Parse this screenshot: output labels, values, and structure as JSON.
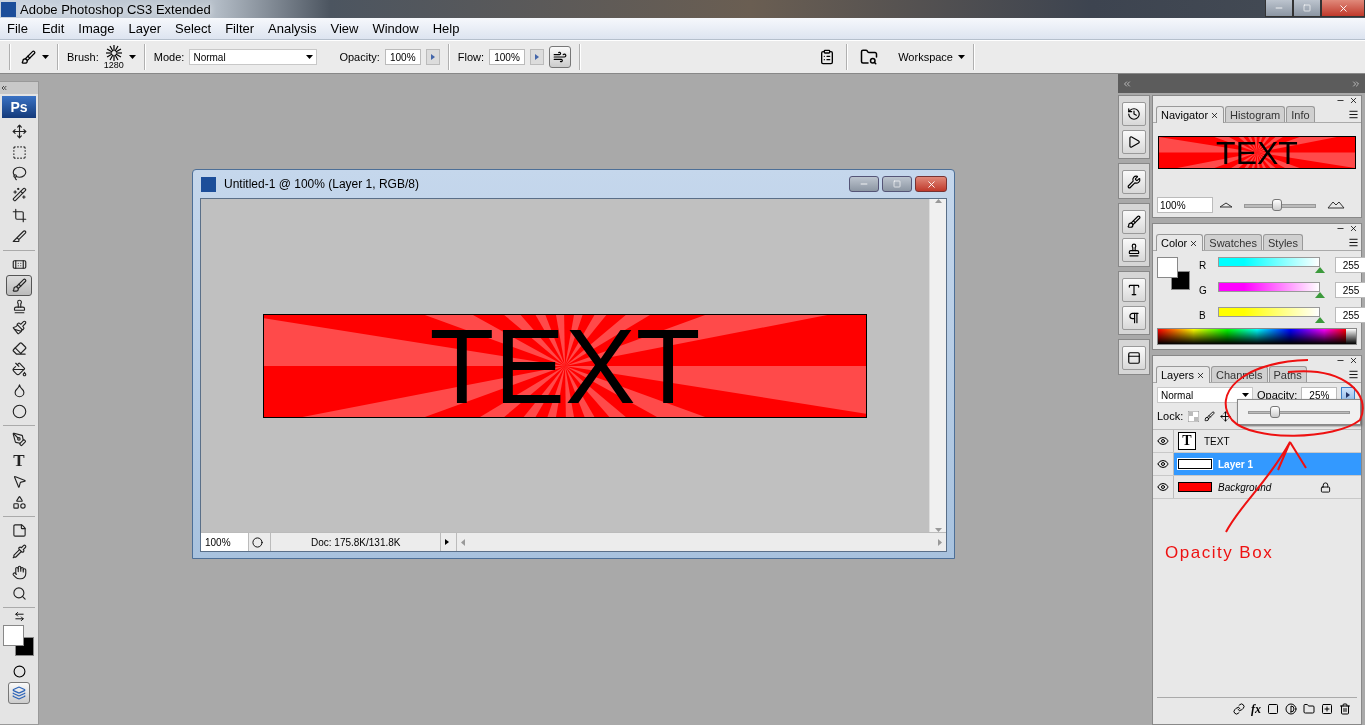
{
  "app": {
    "title": "Adobe Photoshop CS3 Extended"
  },
  "menu": [
    "File",
    "Edit",
    "Image",
    "Layer",
    "Select",
    "Filter",
    "Analysis",
    "View",
    "Window",
    "Help"
  ],
  "options": {
    "brush_label": "Brush:",
    "brush_size": "1280",
    "mode_label": "Mode:",
    "mode": "Normal",
    "opacity_label": "Opacity:",
    "opacity": "100%",
    "flow_label": "Flow:",
    "flow": "100%",
    "workspace": "Workspace"
  },
  "tool_groups": [
    [
      {
        "kind": "move",
        "selected": false
      },
      {
        "kind": "marquee",
        "selected": false
      },
      {
        "kind": "lasso",
        "selected": false
      },
      {
        "kind": "wand",
        "selected": false
      },
      {
        "kind": "crop",
        "selected": false
      },
      {
        "kind": "slice",
        "selected": false
      }
    ],
    [
      {
        "kind": "heal",
        "selected": false
      },
      {
        "kind": "brush",
        "selected": true
      },
      {
        "kind": "stamp",
        "selected": false
      },
      {
        "kind": "history",
        "selected": false
      },
      {
        "kind": "eraser",
        "selected": false
      },
      {
        "kind": "bucket",
        "selected": false
      },
      {
        "kind": "blur",
        "selected": false
      },
      {
        "kind": "dodge",
        "selected": false
      }
    ],
    [
      {
        "kind": "pen",
        "selected": false
      },
      {
        "kind": "type",
        "glyph": "T",
        "selected": false
      },
      {
        "kind": "select",
        "selected": false
      },
      {
        "kind": "shape",
        "selected": false
      }
    ],
    [
      {
        "kind": "notes",
        "selected": false
      },
      {
        "kind": "eyedropper",
        "selected": false
      },
      {
        "kind": "hand",
        "selected": false
      },
      {
        "kind": "zoom",
        "selected": false
      }
    ]
  ],
  "logo": "Ps",
  "document": {
    "title": "Untitled-1 @ 100% (Layer 1, RGB/8)",
    "banner_text": "TEXT",
    "zoom": "100%",
    "info": "Doc: 175.8K/131.8K"
  },
  "navigator": {
    "tabs": [
      {
        "label": "Navigator",
        "selected": true
      },
      {
        "label": "Histogram",
        "selected": false
      },
      {
        "label": "Info",
        "selected": false
      }
    ],
    "preview_text": "TEXT",
    "zoom": "100%",
    "slider": {
      "level": 0.45
    }
  },
  "color": {
    "tabs": [
      {
        "label": "Color",
        "selected": true
      },
      {
        "label": "Swatches",
        "selected": false
      },
      {
        "label": "Styles",
        "selected": false
      }
    ],
    "channels": [
      {
        "name": "R",
        "value": "255",
        "level": 1,
        "color": "#00ffff"
      },
      {
        "name": "G",
        "value": "255",
        "level": 1,
        "color": "#ff00ff"
      },
      {
        "name": "B",
        "value": "255",
        "level": 1,
        "color": "#ffff00"
      }
    ]
  },
  "layers": {
    "tabs": [
      {
        "label": "Layers",
        "selected": true
      },
      {
        "label": "Channels",
        "selected": false
      },
      {
        "label": "Paths",
        "selected": false
      }
    ],
    "blend_mode": "Normal",
    "opacity_label": "Opacity:",
    "opacity": "25%",
    "opacity_slider": {
      "level": 0.25
    },
    "lock_label": "Lock:",
    "items": [
      {
        "name": "TEXT",
        "kind": "text",
        "glyph": "T",
        "visible": true,
        "selected": false,
        "locked": false
      },
      {
        "name": "Layer 1",
        "kind": "pixel",
        "visible": true,
        "selected": true,
        "locked": false
      },
      {
        "name": "Background",
        "kind": "background",
        "visible": true,
        "selected": false,
        "locked": true
      }
    ],
    "footer_fx": "fx"
  },
  "annotation": {
    "label": "Opacity Box"
  }
}
